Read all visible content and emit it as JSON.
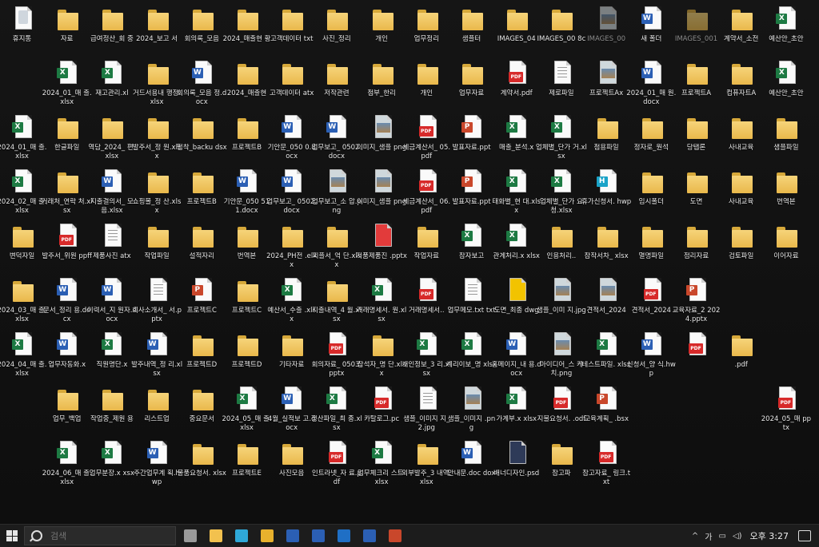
{
  "desktop": {
    "icons": [
      {
        "label": "휴지통",
        "type": "bin"
      },
      {
        "label": "자료",
        "type": "folder"
      },
      {
        "label": "급여정산_회 중",
        "type": "folder"
      },
      {
        "label": "2024_보고 서",
        "type": "folder"
      },
      {
        "label": "회의록_모음",
        "type": "folder"
      },
      {
        "label": "2024_매출현 황",
        "type": "folder"
      },
      {
        "label": "고객데이터 txt",
        "type": "folder"
      },
      {
        "label": "사진_정리",
        "type": "folder"
      },
      {
        "label": "개인",
        "type": "folder"
      },
      {
        "label": "업무정리",
        "type": "folder"
      },
      {
        "label": "샘플터",
        "type": "folder"
      },
      {
        "label": "IMAGES_04",
        "type": "folder"
      },
      {
        "label": "IMAGES_00 8c",
        "type": "folder"
      },
      {
        "label": "IMAGES_00",
        "type": "img",
        "dim": true
      },
      {
        "label": "새 폴더",
        "type": "word"
      },
      {
        "label": "IMAGES_001",
        "type": "folder",
        "dim": true
      },
      {
        "label": "계약서_소전",
        "type": "folder"
      },
      {
        "label": "예산안_초안",
        "type": "excel"
      },
      {
        "label": "2024_01_매 출.xlsx",
        "type": "excel"
      },
      {
        "label": "재고관리.xl",
        "type": "excel"
      },
      {
        "label": "거드서용내 행정.xlsx",
        "type": "folder"
      },
      {
        "label": "회의록_모음 정.docx",
        "type": "word"
      },
      {
        "label": "2024_매출현",
        "type": "folder"
      },
      {
        "label": "고객데이터 atx",
        "type": "folder"
      },
      {
        "label": "저작관련",
        "type": "folder"
      },
      {
        "label": "첨부_한리",
        "type": "folder"
      },
      {
        "label": "개인",
        "type": "folder"
      },
      {
        "label": "업무자료",
        "type": "folder"
      },
      {
        "label": "계약서.pdf",
        "type": "pdf"
      },
      {
        "label": "제로파일",
        "type": "txt"
      },
      {
        "label": "프로젝트Ax",
        "type": "img"
      },
      {
        "label": "2024_01_매 원.docx",
        "type": "word"
      },
      {
        "label": "프로젝트A",
        "type": "folder"
      },
      {
        "label": "컴퓨자트A",
        "type": "folder"
      },
      {
        "label": "예산안_초안",
        "type": "excel"
      },
      {
        "label": "2024_01_매 출.xlsx",
        "type": "excel"
      },
      {
        "label": "한글파일",
        "type": "folder"
      },
      {
        "label": "역담_2024_ 편.xlsx",
        "type": "folder"
      },
      {
        "label": "발주서_정 원.xlsx",
        "type": "folder"
      },
      {
        "label": "펌착_backu dsx",
        "type": "folder"
      },
      {
        "label": "프로젝트B",
        "type": "folder"
      },
      {
        "label": "기안문_050 0.docx",
        "type": "word"
      },
      {
        "label": "업무보고_ 0502.docx",
        "type": "word"
      },
      {
        "label": "이미지_샘플 png",
        "type": "img"
      },
      {
        "label": "세금계산서_ 05.pdf",
        "type": "pdf"
      },
      {
        "label": "발표자료.ppt",
        "type": "ppt"
      },
      {
        "label": "매출_분석.x",
        "type": "excel"
      },
      {
        "label": "업체별_단가 거.xlsx",
        "type": "excel"
      },
      {
        "label": "첨용파일",
        "type": "folder"
      },
      {
        "label": "정자로_원석",
        "type": "folder"
      },
      {
        "label": "당탭론",
        "type": "folder"
      },
      {
        "label": "사내교육",
        "type": "folder"
      },
      {
        "label": "샘플파일",
        "type": "folder"
      },
      {
        "label": "2024_02_매 출.xlsx",
        "type": "excel"
      },
      {
        "label": "거래처_연락 처.xlsx",
        "type": "folder"
      },
      {
        "label": "지출결의서_ 모음.xlsx",
        "type": "word"
      },
      {
        "label": "쇼핑몰_정 산.xlsx",
        "type": "folder"
      },
      {
        "label": "프로젝트B",
        "type": "folder"
      },
      {
        "label": "기안문_050 511.docx",
        "type": "word"
      },
      {
        "label": "업무보고_ 0502.docx",
        "type": "word"
      },
      {
        "label": "업무보고_소 압.png",
        "type": "img"
      },
      {
        "label": "이미지_샘플 png",
        "type": "img"
      },
      {
        "label": "세금계산서_ 06.pdf",
        "type": "pdf"
      },
      {
        "label": "발표자료.ppt",
        "type": "ppt"
      },
      {
        "label": "태화별_현 대.xlsx",
        "type": "excel"
      },
      {
        "label": "업체별_단가 요청.xlsx",
        "type": "excel"
      },
      {
        "label": "휴가신청서. hwp",
        "type": "hwp"
      },
      {
        "label": "임시폴더",
        "type": "folder"
      },
      {
        "label": "도면",
        "type": "folder"
      },
      {
        "label": "사내교육",
        "type": "folder"
      },
      {
        "label": "번역본",
        "type": "folder"
      },
      {
        "label": "변덕자일",
        "type": "folder"
      },
      {
        "label": "발주서_위원 ppff",
        "type": "pdf"
      },
      {
        "label": "제품사진 atx",
        "type": "txt"
      },
      {
        "label": "작업파일",
        "type": "folder"
      },
      {
        "label": "설적자리",
        "type": "folder"
      },
      {
        "label": "번역본",
        "type": "folder"
      },
      {
        "label": "2024_PH전 .elxx",
        "type": "folder"
      },
      {
        "label": "피플서_억 단.xlsx",
        "type": "folder"
      },
      {
        "label": "저품제품진 .pptx",
        "type": "zip"
      },
      {
        "label": "작업자료",
        "type": "folder"
      },
      {
        "label": "참자보고",
        "type": "excel"
      },
      {
        "label": "관계처리.x xlsx",
        "type": "excel"
      },
      {
        "label": "인용처리..",
        "type": "folder"
      },
      {
        "label": "참작서차_ xlsx",
        "type": "folder"
      },
      {
        "label": "멸명파일",
        "type": "folder"
      },
      {
        "label": "점리자료",
        "type": "folder"
      },
      {
        "label": "검토파일",
        "type": "folder"
      },
      {
        "label": "이어자료",
        "type": "folder"
      },
      {
        "label": "2024_03_매 출.xlsx",
        "type": "folder"
      },
      {
        "label": "문서_정리 용.docx",
        "type": "word"
      },
      {
        "label": "이력서_지 원자.docx",
        "type": "word"
      },
      {
        "label": "회사소개서_ 서.pptx",
        "type": "txt"
      },
      {
        "label": "프로젝트C",
        "type": "ppt"
      },
      {
        "label": "프로젝트C",
        "type": "folder"
      },
      {
        "label": "예산서_수출 .xlsx",
        "type": "excel"
      },
      {
        "label": "지출내역_4 월.xlsx",
        "type": "folder"
      },
      {
        "label": "거래명세서. 원.xlsx",
        "type": "excel"
      },
      {
        "label": "거래명세서..",
        "type": "pdf"
      },
      {
        "label": "업무메모.txt txt",
        "type": "txt"
      },
      {
        "label": "도면_최종 dwg",
        "type": "dwg"
      },
      {
        "label": "샘플_이미 지.jpg",
        "type": "img"
      },
      {
        "label": "견적서_2024",
        "type": "img"
      },
      {
        "label": "견적서_2024",
        "type": "pdf"
      },
      {
        "label": "교육자료_2 2024.pptx",
        "type": "ppt"
      },
      {
        "label": "2024_04_매 출.xlsx",
        "type": "excel"
      },
      {
        "label": "업무자동화.x",
        "type": "word"
      },
      {
        "label": "직원명단.x",
        "type": "excel"
      },
      {
        "label": "발주내역_정 리.xlsx",
        "type": "word"
      },
      {
        "label": "프로젝트D",
        "type": "folder"
      },
      {
        "label": "프로젝트D",
        "type": "folder"
      },
      {
        "label": "기타자료",
        "type": "folder"
      },
      {
        "label": "회의자료_ 0503.pptx",
        "type": "pdf"
      },
      {
        "label": "참석자_명 단.xlsx",
        "type": "folder"
      },
      {
        "label": "개인정보_3 리.xlsx",
        "type": "excel"
      },
      {
        "label": "계리이보_명 xlsx",
        "type": "excel"
      },
      {
        "label": "홈메이지_내 용.docx",
        "type": "word"
      },
      {
        "label": "아이디어_스 케치.png",
        "type": "img"
      },
      {
        "label": "테스트파일. xlsx",
        "type": "excel"
      },
      {
        "label": "신청서_양 식.hwp",
        "type": "word"
      },
      {
        "label": "",
        "type": "pdf"
      },
      {
        "label": ".pdf",
        "type": "folder"
      },
      {
        "label": "업무_백업",
        "type": "folder"
      },
      {
        "label": "작업중_제원 용",
        "type": "folder"
      },
      {
        "label": "리스트업",
        "type": "folder"
      },
      {
        "label": "중요문서",
        "type": "folder"
      },
      {
        "label": "2024_05_매 출.xlsx",
        "type": "excel"
      },
      {
        "label": "4월_실적보 고.docx",
        "type": "word"
      },
      {
        "label": "정산파일_최 종.xlsx",
        "type": "excel"
      },
      {
        "label": "카탈로그.pc",
        "type": "pdf"
      },
      {
        "label": "샘플_이미지 지_2.jpg",
        "type": "txt"
      },
      {
        "label": "샘플_이미지 .png",
        "type": "img"
      },
      {
        "label": "가계부.x xlsx",
        "type": "excel"
      },
      {
        "label": "지불요청서. .odf",
        "type": "pdf"
      },
      {
        "label": "교육계획_ .bsx",
        "type": "ppt"
      },
      {
        "label": "2024_05_매 pptx",
        "type": "pdf"
      },
      {
        "label": "2024_06_매 출.xlsx",
        "type": "excel"
      },
      {
        "label": "업무분장.x xsx",
        "type": "excel"
      },
      {
        "label": "주간업무계 획.hwp",
        "type": "word"
      },
      {
        "label": "물품요청서. xlsx",
        "type": "folder"
      },
      {
        "label": "프로젝트E",
        "type": "folder"
      },
      {
        "label": "사진모음",
        "type": "folder"
      },
      {
        "label": "인트라넷_자 료.pdf",
        "type": "pdf"
      },
      {
        "label": "업무체크리 스트.xlsx",
        "type": "excel"
      },
      {
        "label": "외부발주_3 내역.xlsx",
        "type": "folder"
      },
      {
        "label": "안내문.doc dox",
        "type": "word"
      },
      {
        "label": "배너디자인.psd",
        "type": "psd"
      },
      {
        "label": "참고파",
        "type": "folder"
      },
      {
        "label": "참고자료_ 링크.txt",
        "type": "pdf"
      }
    ]
  },
  "taskbar": {
    "search_placeholder": "검색",
    "apps": [
      {
        "name": "task-view",
        "color": "#9a9a9a"
      },
      {
        "name": "file-explorer",
        "color": "#f2c14e"
      },
      {
        "name": "edge",
        "color": "#2fa8d8"
      },
      {
        "name": "chrome",
        "color": "#e8b12d"
      },
      {
        "name": "word",
        "color": "#2b5fb4"
      },
      {
        "name": "word",
        "color": "#2b5fb4"
      },
      {
        "name": "outlook",
        "color": "#1f6fc5"
      },
      {
        "name": "word",
        "color": "#2b5fb4"
      },
      {
        "name": "powerpoint",
        "color": "#c9472b"
      }
    ],
    "tray": {
      "chevron": "^",
      "lang": "가",
      "clock_ampm": "오후",
      "clock_time": "3:27"
    }
  }
}
